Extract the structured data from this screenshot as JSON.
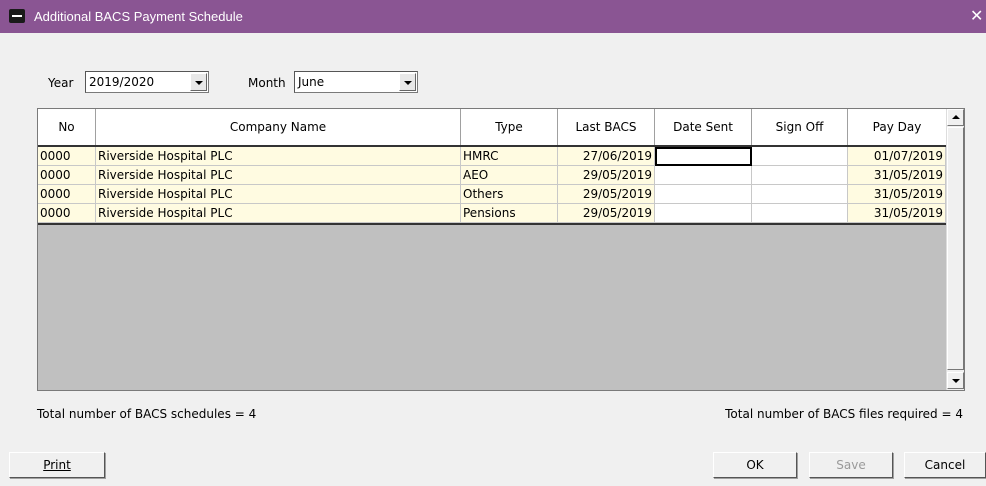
{
  "window": {
    "title": "Additional BACS Payment Schedule"
  },
  "filters": {
    "year_label": "Year",
    "year_value": "2019/2020",
    "month_label": "Month",
    "month_value": "June"
  },
  "table": {
    "columns": [
      "No",
      "Company Name",
      "Type",
      "Last BACS",
      "Date Sent",
      "Sign Off",
      "Pay Day"
    ],
    "rows": [
      {
        "no": "0000",
        "company": "Riverside Hospital PLC",
        "type": "HMRC",
        "last_bacs": "27/06/2019",
        "date_sent": "",
        "sign_off": "",
        "pay_day": "01/07/2019"
      },
      {
        "no": "0000",
        "company": "Riverside Hospital PLC",
        "type": "AEO",
        "last_bacs": "29/05/2019",
        "date_sent": "",
        "sign_off": "",
        "pay_day": "31/05/2019"
      },
      {
        "no": "0000",
        "company": "Riverside Hospital PLC",
        "type": "Others",
        "last_bacs": "29/05/2019",
        "date_sent": "",
        "sign_off": "",
        "pay_day": "31/05/2019"
      },
      {
        "no": "0000",
        "company": "Riverside Hospital PLC",
        "type": "Pensions",
        "last_bacs": "29/05/2019",
        "date_sent": "",
        "sign_off": "",
        "pay_day": "31/05/2019"
      }
    ]
  },
  "footer": {
    "schedules_text": "Total number of BACS schedules = 4",
    "files_text": "Total number of BACS files required = 4"
  },
  "buttons": {
    "print": "Print",
    "ok": "OK",
    "save": "Save",
    "cancel": "Cancel"
  }
}
